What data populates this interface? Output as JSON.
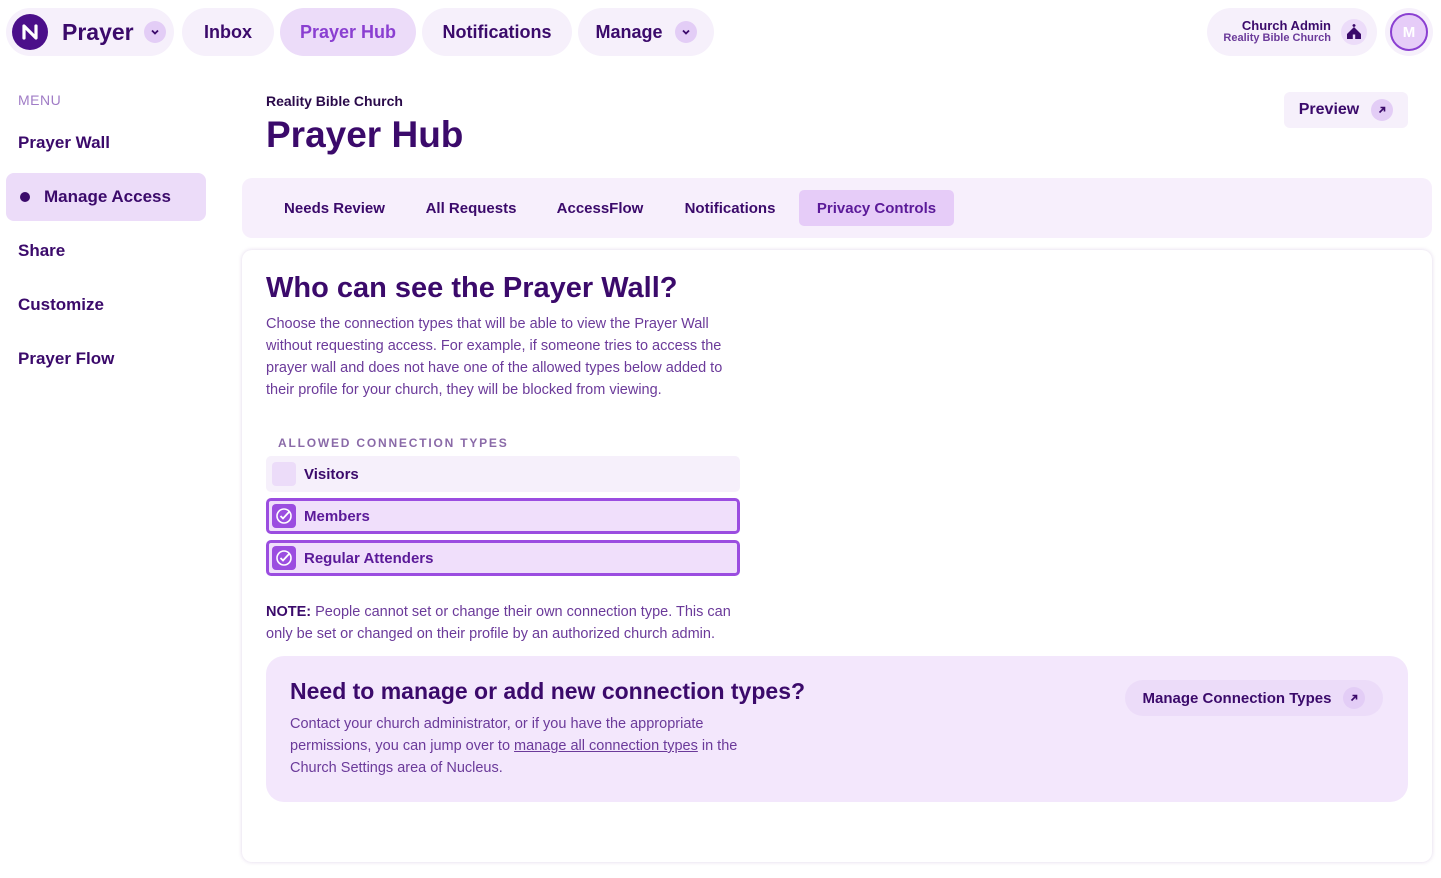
{
  "topnav": {
    "app_name": "Prayer",
    "items": [
      {
        "label": "Inbox"
      },
      {
        "label": "Prayer Hub"
      },
      {
        "label": "Notifications"
      },
      {
        "label": "Manage"
      }
    ],
    "account": {
      "name": "Church Admin",
      "church": "Reality Bible Church",
      "avatar_initial": "M"
    }
  },
  "sidebar": {
    "menu_label": "MENU",
    "items": [
      {
        "label": "Prayer Wall"
      },
      {
        "label": "Manage Access"
      },
      {
        "label": "Share"
      },
      {
        "label": "Customize"
      },
      {
        "label": "Prayer Flow"
      }
    ]
  },
  "header": {
    "church": "Reality Bible Church",
    "title": "Prayer Hub",
    "preview_label": "Preview"
  },
  "tabs": [
    {
      "label": "Needs Review"
    },
    {
      "label": "All Requests"
    },
    {
      "label": "AccessFlow"
    },
    {
      "label": "Notifications"
    },
    {
      "label": "Privacy Controls"
    }
  ],
  "privacy": {
    "title": "Who can see the Prayer Wall?",
    "description": "Choose the connection types that will be able to view the Prayer Wall without requesting access. For example, if someone tries to access the prayer wall and does not have one of the allowed types below added to their profile for your church, they will be blocked from viewing.",
    "allowed_label": "ALLOWED CONNECTION TYPES",
    "connection_types": [
      {
        "label": "Visitors",
        "checked": false
      },
      {
        "label": "Members",
        "checked": true
      },
      {
        "label": "Regular Attenders",
        "checked": true
      }
    ],
    "note_prefix": "NOTE:",
    "note_text": " People cannot set or change their own connection type. This can only be set or changed on their profile by an authorized church admin."
  },
  "manage_box": {
    "title": "Need to manage or add new connection types?",
    "desc_before": "Contact your church administrator, or if you have the appropriate permissions, you can jump over to ",
    "link_text": "manage all connection types",
    "desc_after": " in the Church Settings area of Nucleus.",
    "button_label": "Manage Connection Types"
  },
  "colors": {
    "accent": "#9b4de0",
    "primary_text": "#3b0a6b",
    "active_bg": "#ecdcf9"
  },
  "icons": {
    "logo": "nucleus-logo-icon",
    "chevron": "chevron-down-icon",
    "arrow": "arrow-up-right-icon",
    "church": "church-icon",
    "check": "check-icon"
  }
}
